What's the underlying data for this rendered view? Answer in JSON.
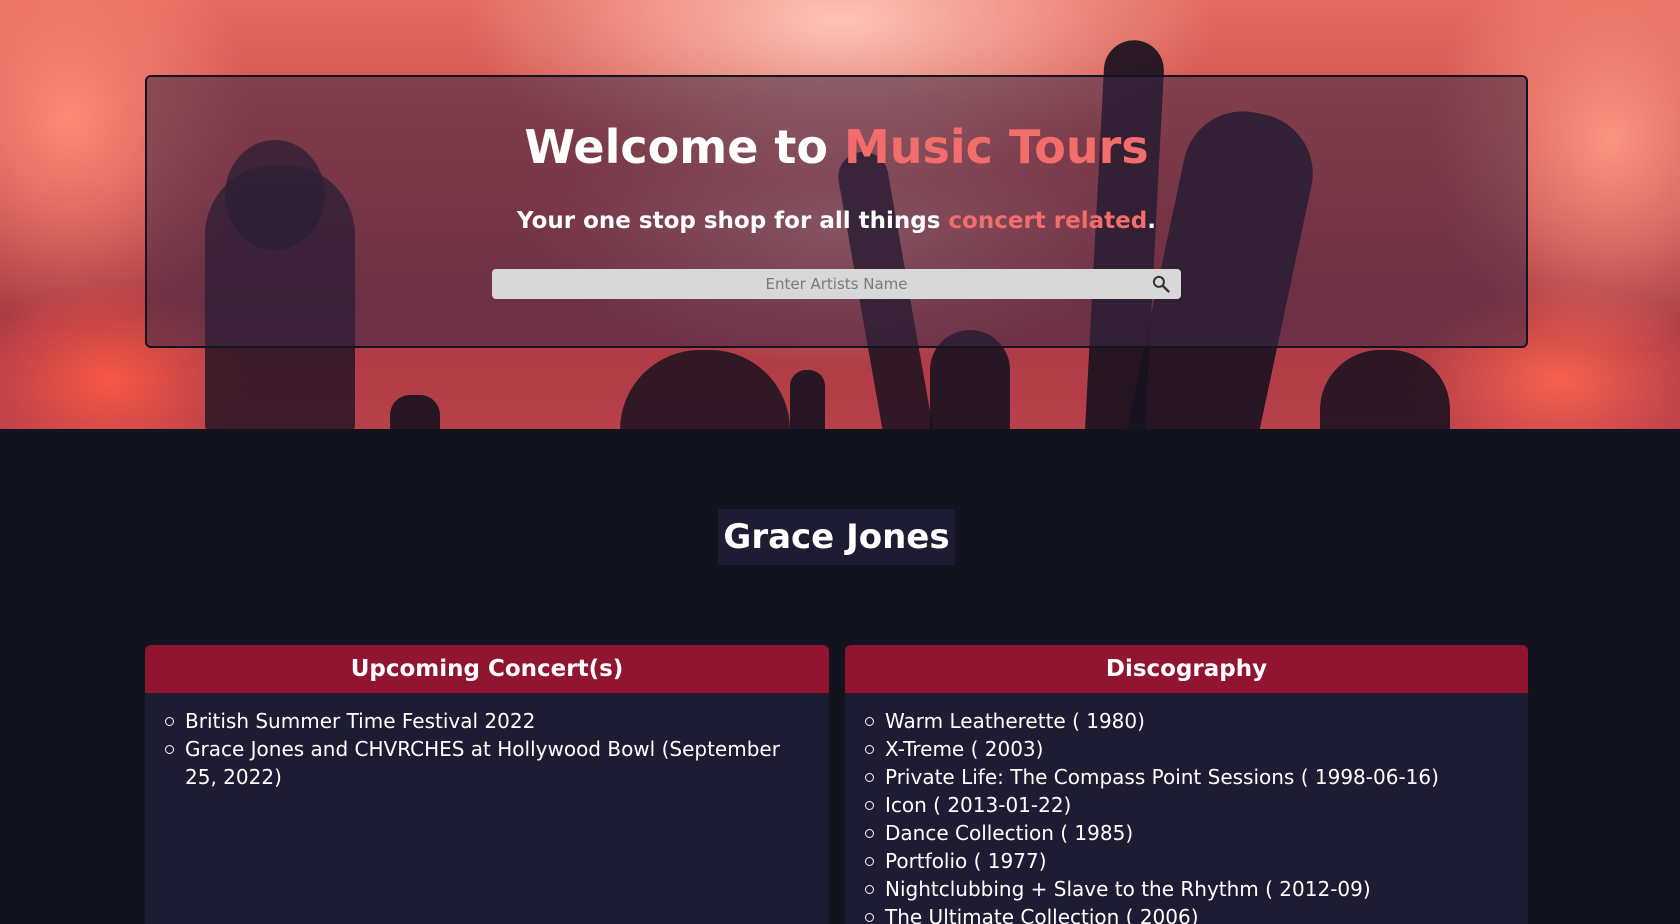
{
  "hero": {
    "title_prefix": "Welcome to ",
    "title_accent": "Music Tours",
    "subtitle_prefix": "Your one stop shop for all things ",
    "subtitle_accent": "concert related",
    "subtitle_suffix": ".",
    "search": {
      "placeholder": "Enter Artists Name",
      "value": "",
      "icon": "search-icon"
    }
  },
  "artist": {
    "name": "Grace Jones"
  },
  "concerts": {
    "header": "Upcoming Concert(s)",
    "items": [
      "British Summer Time Festival 2022",
      "Grace Jones and CHVRCHES at Hollywood Bowl (September 25, 2022)"
    ]
  },
  "discography": {
    "header": "Discography",
    "items": [
      "Warm Leatherette ( 1980)",
      "X-Treme ( 2003)",
      "Private Life: The Compass Point Sessions ( 1998-06-16)",
      "Icon ( 2013-01-22)",
      "Dance Collection ( 1985)",
      "Portfolio ( 1977)",
      "Nightclubbing + Slave to the Rhythm ( 2012-09)",
      "The Ultimate Collection ( 2006)"
    ]
  },
  "colors": {
    "accent": "#f46d6d",
    "panel_header": "#911531",
    "panel_bg": "#1e1c33",
    "page_bg": "#13131f"
  }
}
